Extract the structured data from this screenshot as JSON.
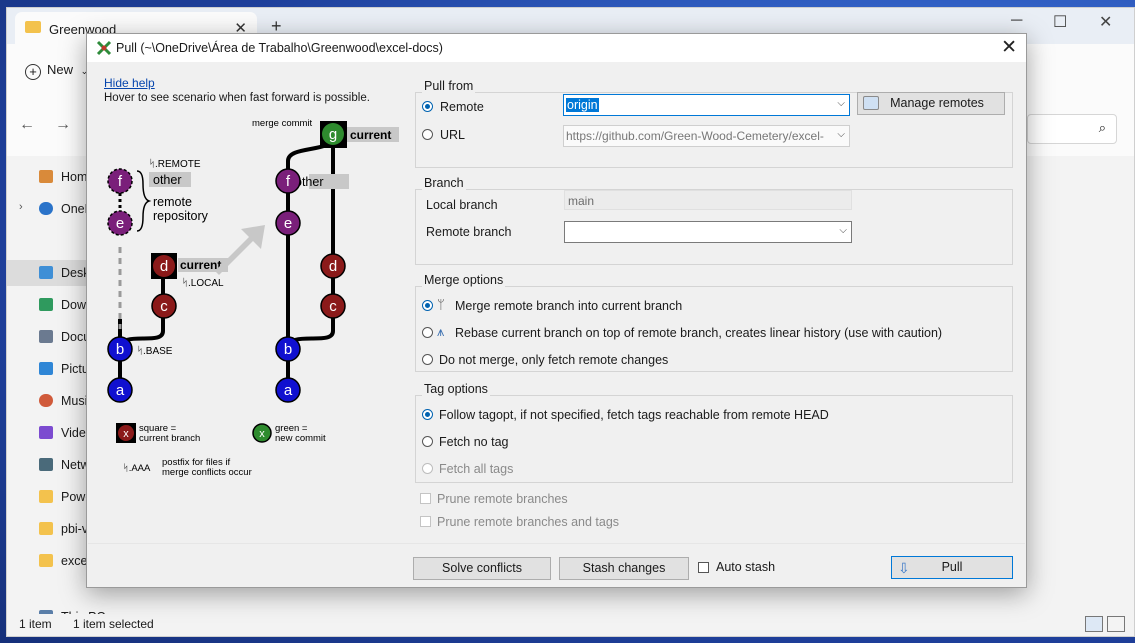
{
  "explorer": {
    "tab_title": "Greenwood",
    "tab_close": "✕",
    "new_tab": "+",
    "minimize": "─",
    "maximize": "☐",
    "close": "✕",
    "new_label": "New",
    "back": "←",
    "forward": "→",
    "search_icon": "⌕",
    "sidebar": [
      {
        "label": "Home",
        "icon": "home-icon",
        "color": "#d98a3a"
      },
      {
        "label": "OneDrive",
        "icon": "cloud-icon",
        "color": "#2a73c9"
      },
      {
        "label": "Desktop",
        "icon": "desktop-icon",
        "color": "#3f8fd6"
      },
      {
        "label": "Downloads",
        "icon": "download-icon",
        "color": "#2f9a5e"
      },
      {
        "label": "Documents",
        "icon": "document-icon",
        "color": "#6b7a90"
      },
      {
        "label": "Pictures",
        "icon": "picture-icon",
        "color": "#2f86d6"
      },
      {
        "label": "Music",
        "icon": "music-icon",
        "color": "#d05a3a"
      },
      {
        "label": "Videos",
        "icon": "video-icon",
        "color": "#7c4bd0"
      },
      {
        "label": "Network",
        "icon": "network-icon",
        "color": "#4a6a7a"
      },
      {
        "label": "Power",
        "icon": "folder-icon",
        "color": "#f3c24d"
      },
      {
        "label": "pbi-v",
        "icon": "folder-icon",
        "color": "#f3c24d"
      },
      {
        "label": "excel",
        "icon": "folder-icon",
        "color": "#f3c24d"
      },
      {
        "label": "This PC",
        "icon": "pc-icon",
        "color": "#5a7ea8"
      }
    ],
    "status_count": "1 item",
    "status_selected": "1 item selected"
  },
  "dialog": {
    "title": "Pull (~\\OneDrive\\Área de Trabalho\\Greenwood\\excel-docs)",
    "close": "✕",
    "help_link": "Hide help",
    "help_hover": "Hover to see scenario when fast forward is possible.",
    "diagram": {
      "remote_tag": "ᛋ.REMOTE",
      "other_tag": "other",
      "remote_repo": "remote",
      "remote_repo2": "repository",
      "current_tag": "current",
      "local_tag": "ᛋ.LOCAL",
      "base_tag": "ᛋ.BASE",
      "merge_commit": "merge commit",
      "other_tag2": "other",
      "current_tag2": "current",
      "nodes": {
        "a": "a",
        "b": "b",
        "c": "c",
        "d": "d",
        "e": "e",
        "f": "f",
        "g": "g"
      },
      "legend_x": "x",
      "legend_square": "square =",
      "legend_current": "current branch",
      "legend_green": "green =",
      "legend_new": "new commit",
      "legend_aaa": "ᛋ.AAA",
      "legend_postfix": "postfix for files if",
      "legend_merge": "merge conflicts occur"
    },
    "pull_from": {
      "title": "Pull from",
      "remote_label": "Remote",
      "remote_value": "origin",
      "manage_remotes": "Manage remotes",
      "url_label": "URL",
      "url_value": "https://github.com/Green-Wood-Cemetery/excel-"
    },
    "branch": {
      "title": "Branch",
      "local_label": "Local branch",
      "local_value": "main",
      "remote_label": "Remote branch",
      "remote_value": ""
    },
    "merge": {
      "title": "Merge options",
      "opt1": "Merge remote branch into current branch",
      "opt2": "Rebase current branch on top of remote branch, creates linear history (use with caution)",
      "opt3": "Do not merge, only fetch remote changes"
    },
    "tags": {
      "title": "Tag options",
      "opt1": "Follow tagopt, if not specified, fetch tags reachable from remote HEAD",
      "opt2": "Fetch no tag",
      "opt3": "Fetch all tags"
    },
    "prune1": "Prune remote branches",
    "prune2": "Prune remote branches and tags",
    "buttons": {
      "solve": "Solve conflicts",
      "stash": "Stash changes",
      "auto_stash": "Auto stash",
      "pull": "Pull"
    }
  }
}
